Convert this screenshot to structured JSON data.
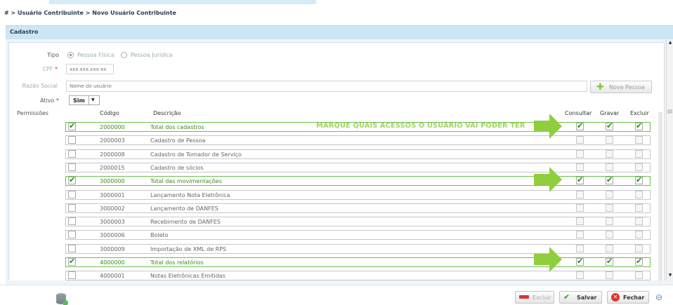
{
  "breadcrumb": "# > Usuário Contribuinte > Novo Usuário Contribuinte",
  "panel_title": "Cadastro",
  "form": {
    "tipo_label": "Tipo",
    "tipo_options": [
      "Pessoa Física",
      "Pessoa Jurídica"
    ],
    "cpf_label": "CPF",
    "cpf_placeholder": "xxx.xxx.xxx-xx",
    "razao_label": "Razão Social",
    "razao_placeholder": "Nome do usuário",
    "nova_pessoa_label": "Nova Pessoa",
    "ativo_label": "Ativo",
    "ativo_value": "Sim",
    "permissoes_label": "Permissões"
  },
  "table": {
    "headers": {
      "codigo": "Código",
      "descricao": "Descrição",
      "consultar": "Consultar",
      "gravar": "Gravar",
      "excluir": "Excluir"
    },
    "rows": [
      {
        "code": "2000000",
        "desc": "Total dos cadastros",
        "highlight": true
      },
      {
        "code": "2000003",
        "desc": "Cadastro de Pessoa",
        "highlight": false
      },
      {
        "code": "2000008",
        "desc": "Cadastro de Tomador de Serviço",
        "highlight": false
      },
      {
        "code": "2000015",
        "desc": "Cadastro de sócios",
        "highlight": false
      },
      {
        "code": "3000000",
        "desc": "Total das movimentações",
        "highlight": true
      },
      {
        "code": "3000001",
        "desc": "Lançamento Nota Eletrônica",
        "highlight": false
      },
      {
        "code": "3000002",
        "desc": "Lançamento de DANFES",
        "highlight": false
      },
      {
        "code": "3000003",
        "desc": "Recebimento de DANFES",
        "highlight": false
      },
      {
        "code": "3000006",
        "desc": "Boleto",
        "highlight": false
      },
      {
        "code": "3000009",
        "desc": "Importação de XML de RPS",
        "highlight": false
      },
      {
        "code": "4000000",
        "desc": "Total dos relatórios",
        "highlight": true
      },
      {
        "code": "4000001",
        "desc": "Notas Eletrônicas Emitidas",
        "highlight": false
      }
    ]
  },
  "annotation": "MARQUE QUAIS ACESSOS O USUÁRIO VAI PODER TER",
  "footer": {
    "excluir": "Excluir",
    "salvar": "Salvar",
    "fechar": "Fechar"
  },
  "colors": {
    "highlight": "#6bbf4e",
    "annotation": "#a4d65e",
    "header": "#cde6f5"
  }
}
